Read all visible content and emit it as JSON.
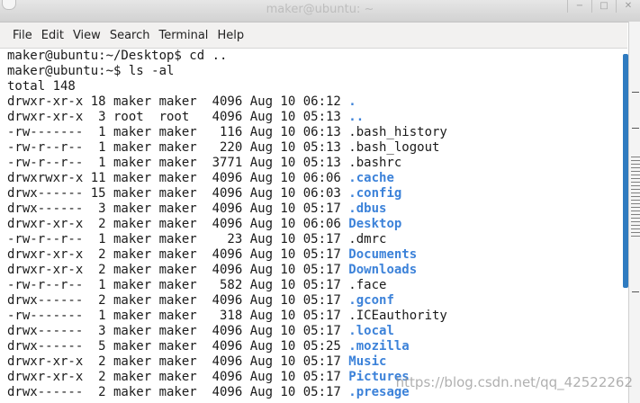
{
  "window": {
    "title": "maker@ubuntu: ~",
    "controls": [
      "−",
      "□",
      "✕"
    ]
  },
  "menubar": {
    "items": [
      "File",
      "Edit",
      "View",
      "Search",
      "Terminal",
      "Help"
    ]
  },
  "terminal": {
    "lines": [
      {
        "text": "maker@ubuntu:~/Desktop$ cd ..",
        "dir": ""
      },
      {
        "text": "maker@ubuntu:~$ ls -al",
        "dir": ""
      },
      {
        "text": "total 148",
        "dir": ""
      },
      {
        "text": "drwxr-xr-x 18 maker maker  4096 Aug 10 06:12 ",
        "dir": "."
      },
      {
        "text": "drwxr-xr-x  3 root  root   4096 Aug 10 05:13 ",
        "dir": ".."
      },
      {
        "text": "-rw-------  1 maker maker   116 Aug 10 06:13 .bash_history",
        "dir": ""
      },
      {
        "text": "-rw-r--r--  1 maker maker   220 Aug 10 05:13 .bash_logout",
        "dir": ""
      },
      {
        "text": "-rw-r--r--  1 maker maker  3771 Aug 10 05:13 .bashrc",
        "dir": ""
      },
      {
        "text": "drwxrwxr-x 11 maker maker  4096 Aug 10 06:06 ",
        "dir": ".cache"
      },
      {
        "text": "drwx------ 15 maker maker  4096 Aug 10 06:03 ",
        "dir": ".config"
      },
      {
        "text": "drwx------  3 maker maker  4096 Aug 10 05:17 ",
        "dir": ".dbus"
      },
      {
        "text": "drwxr-xr-x  2 maker maker  4096 Aug 10 06:06 ",
        "dir": "Desktop"
      },
      {
        "text": "-rw-r--r--  1 maker maker    23 Aug 10 05:17 .dmrc",
        "dir": ""
      },
      {
        "text": "drwxr-xr-x  2 maker maker  4096 Aug 10 05:17 ",
        "dir": "Documents"
      },
      {
        "text": "drwxr-xr-x  2 maker maker  4096 Aug 10 05:17 ",
        "dir": "Downloads"
      },
      {
        "text": "-rw-r--r--  1 maker maker   582 Aug 10 05:17 .face",
        "dir": ""
      },
      {
        "text": "drwx------  2 maker maker  4096 Aug 10 05:17 ",
        "dir": ".gconf"
      },
      {
        "text": "-rw-------  1 maker maker   318 Aug 10 05:17 .ICEauthority",
        "dir": ""
      },
      {
        "text": "drwx------  3 maker maker  4096 Aug 10 05:17 ",
        "dir": ".local"
      },
      {
        "text": "drwx------  5 maker maker  4096 Aug 10 05:25 ",
        "dir": ".mozilla"
      },
      {
        "text": "drwxr-xr-x  2 maker maker  4096 Aug 10 05:17 ",
        "dir": "Music"
      },
      {
        "text": "drwxr-xr-x  2 maker maker  4096 Aug 10 05:17 ",
        "dir": "Pictures"
      },
      {
        "text": "drwx------  2 maker maker  4096 Aug 10 05:17 ",
        "dir": ".presage"
      }
    ]
  },
  "watermark": "https://blog.csdn.net/qq_42522262",
  "colors": {
    "directory": "#3c82d9",
    "scroll_thumb": "#2f7bc0",
    "text": "#1a1a1a"
  }
}
